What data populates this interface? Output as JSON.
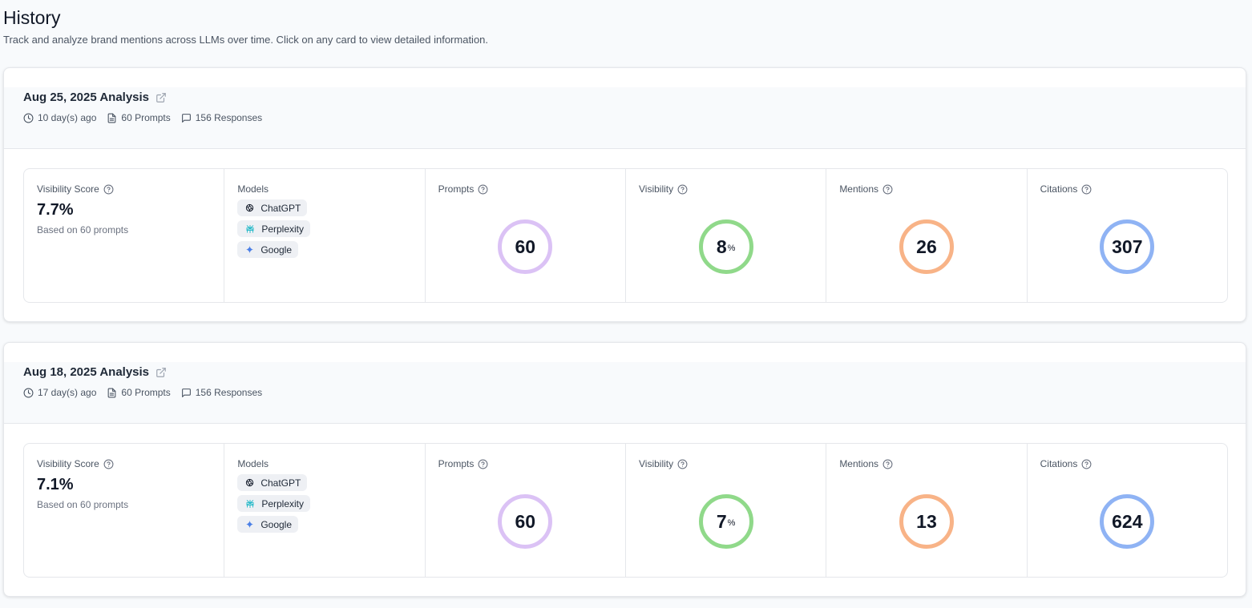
{
  "page": {
    "title": "History",
    "subtitle": "Track and analyze brand mentions across LLMs over time. Click on any card to view detailed information."
  },
  "labels": {
    "visibility_score": "Visibility Score",
    "models": "Models",
    "prompts": "Prompts",
    "visibility": "Visibility",
    "mentions": "Mentions",
    "citations": "Citations",
    "percent_suffix": "%"
  },
  "colors": {
    "prompts_ring": "#dbc2f5",
    "visibility_ring": "#90d98a",
    "mentions_ring": "#f8b387",
    "citations_ring": "#8fb3f4"
  },
  "analyses": [
    {
      "title": "Aug 25, 2025 Analysis",
      "age": "10 day(s) ago",
      "prompts_meta": "60 Prompts",
      "responses_meta": "156 Responses",
      "score": "7.7%",
      "score_sub": "Based on 60 prompts",
      "models": [
        {
          "name": "ChatGPT",
          "icon": "chatgpt-icon"
        },
        {
          "name": "Perplexity",
          "icon": "perplexity-icon"
        },
        {
          "name": "Google",
          "icon": "gemini-icon"
        }
      ],
      "prompts": "60",
      "visibility": "8",
      "mentions": "26",
      "citations": "307"
    },
    {
      "title": "Aug 18, 2025 Analysis",
      "age": "17 day(s) ago",
      "prompts_meta": "60 Prompts",
      "responses_meta": "156 Responses",
      "score": "7.1%",
      "score_sub": "Based on 60 prompts",
      "models": [
        {
          "name": "ChatGPT",
          "icon": "chatgpt-icon"
        },
        {
          "name": "Perplexity",
          "icon": "perplexity-icon"
        },
        {
          "name": "Google",
          "icon": "gemini-icon"
        }
      ],
      "prompts": "60",
      "visibility": "7",
      "mentions": "13",
      "citations": "624"
    }
  ]
}
